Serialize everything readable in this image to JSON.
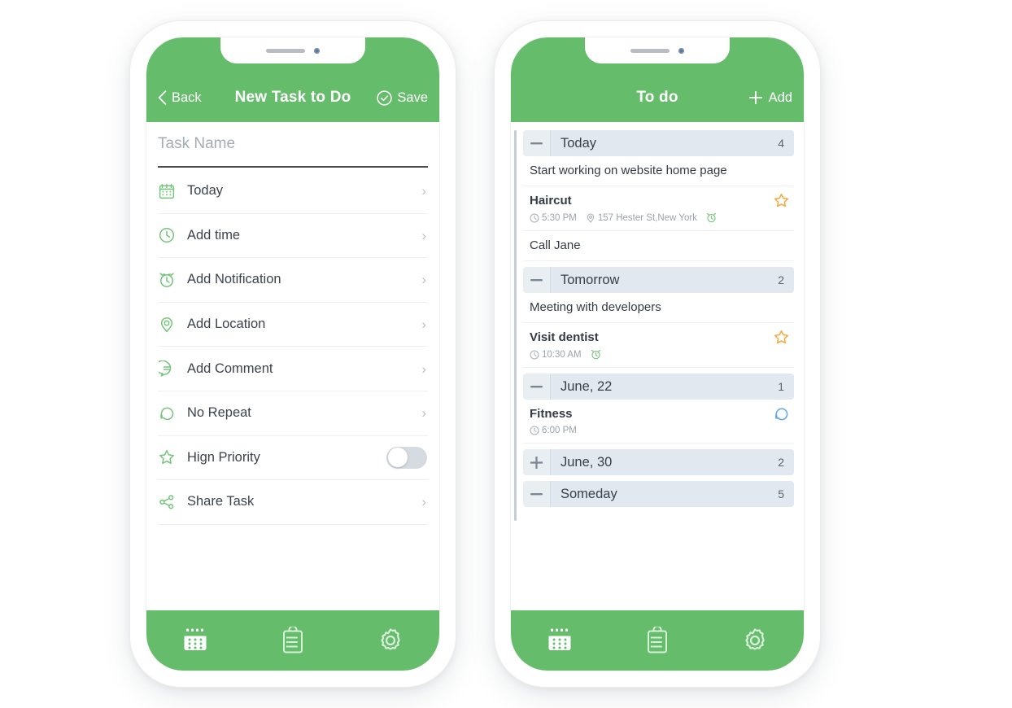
{
  "colors": {
    "brand_green": "#65bc6b",
    "icon_green": "#74c47a",
    "group_header_bg": "#e2e8ef",
    "star_orange": "#f5a940",
    "repeat_blue": "#5aa9f0",
    "text_dark": "#343b45",
    "text_muted": "#9aa3ad"
  },
  "left_phone": {
    "header": {
      "back_label": "Back",
      "title": "New Task to Do",
      "save_label": "Save",
      "back_icon": "chevron-left-icon",
      "save_icon": "check-circle-icon"
    },
    "task_name": {
      "value": "",
      "placeholder": "Task Name"
    },
    "rows": [
      {
        "label": "Today",
        "icon": "calendar-icon",
        "control": "chevron"
      },
      {
        "label": "Add time",
        "icon": "clock-icon",
        "control": "chevron"
      },
      {
        "label": "Add Notification",
        "icon": "alarm-clock-icon",
        "control": "chevron"
      },
      {
        "label": "Add Location",
        "icon": "location-pin-icon",
        "control": "chevron"
      },
      {
        "label": "Add Comment",
        "icon": "comment-icon",
        "control": "chevron"
      },
      {
        "label": "No Repeat",
        "icon": "repeat-icon",
        "control": "chevron"
      },
      {
        "label": "Hign Priority",
        "icon": "star-icon",
        "control": "toggle",
        "toggle_on": false
      },
      {
        "label": "Share Task",
        "icon": "share-icon",
        "control": "chevron"
      }
    ],
    "chevron_glyph": "›",
    "tabs": [
      {
        "icon": "calendar-tab-icon",
        "active": true
      },
      {
        "icon": "clipboard-tab-icon",
        "active": false
      },
      {
        "icon": "settings-gear-icon",
        "active": false
      }
    ]
  },
  "right_phone": {
    "header": {
      "title": "To do",
      "add_label": "Add",
      "add_icon": "plus-icon"
    },
    "groups": [
      {
        "name": "Today",
        "count": "4",
        "toggle": "minus",
        "tasks": [
          {
            "title": "Start working on website home page",
            "meta": [],
            "badge": "none"
          },
          {
            "title": "Haircut",
            "meta": [
              {
                "icon": "clock-icon",
                "text": "5:30 PM"
              },
              {
                "icon": "location-pin-icon",
                "text": "157 Hester St,New York"
              },
              {
                "icon": "alarm-clock-icon",
                "text": ""
              }
            ],
            "badge": "star"
          },
          {
            "title": "Call Jane",
            "meta": [],
            "badge": "none"
          }
        ]
      },
      {
        "name": "Tomorrow",
        "count": "2",
        "toggle": "minus",
        "tasks": [
          {
            "title": "Meeting with developers",
            "meta": [],
            "badge": "none"
          },
          {
            "title": "Visit dentist",
            "meta": [
              {
                "icon": "clock-icon",
                "text": "10:30 AM"
              },
              {
                "icon": "alarm-clock-icon",
                "text": ""
              }
            ],
            "badge": "star"
          }
        ]
      },
      {
        "name": "June, 22",
        "count": "1",
        "toggle": "minus",
        "tasks": [
          {
            "title": "Fitness",
            "meta": [
              {
                "icon": "clock-icon",
                "text": "6:00 PM"
              }
            ],
            "badge": "repeat"
          }
        ]
      },
      {
        "name": "June, 30",
        "count": "2",
        "toggle": "plus",
        "tasks": []
      },
      {
        "name": "Someday",
        "count": "5",
        "toggle": "minus",
        "tasks": []
      }
    ],
    "tabs": [
      {
        "icon": "calendar-tab-icon",
        "active": true
      },
      {
        "icon": "clipboard-tab-icon",
        "active": false
      },
      {
        "icon": "settings-gear-icon",
        "active": false
      }
    ]
  }
}
